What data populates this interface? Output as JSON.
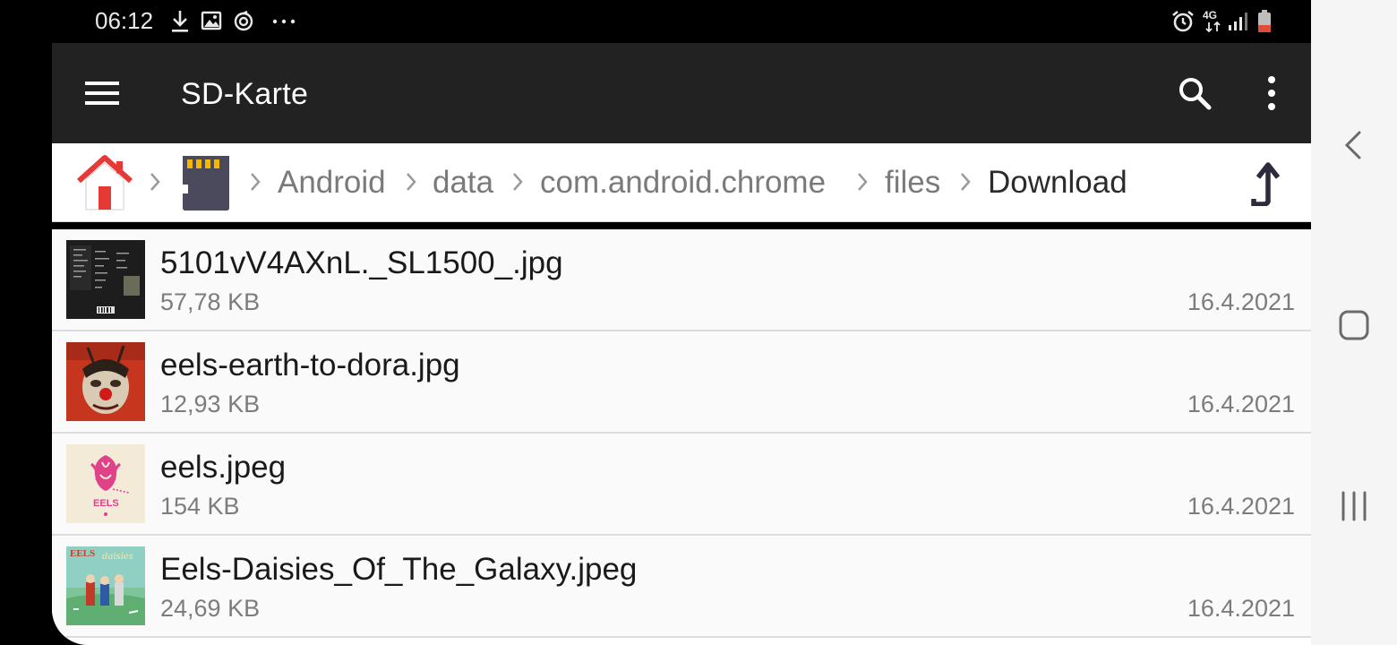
{
  "status_bar": {
    "time": "06:12",
    "left_icons": [
      "download-icon",
      "image-icon",
      "sync-icon",
      "more-dots-icon"
    ],
    "network": "4G",
    "right_icons": [
      "alarm-icon",
      "network-4g-icon",
      "signal-icon",
      "battery-icon"
    ]
  },
  "toolbar": {
    "title": "SD-Karte",
    "menu_icon": "hamburger-menu-icon",
    "search_icon": "search-icon",
    "overflow_icon": "overflow-menu-icon",
    "background": "#222222"
  },
  "breadcrumb": {
    "home_icon": "home-icon",
    "sd_icon": "sd-card-icon",
    "items": [
      "Android",
      "data",
      "com.android.chrome",
      "files",
      "Download"
    ],
    "up_icon": "up-arrow-icon"
  },
  "files": [
    {
      "name": "5101vV4AXnL._SL1500_.jpg",
      "size": "57,78 KB",
      "date": "16.4.2021",
      "thumb": "dark-album-back-thumbnail"
    },
    {
      "name": "eels-earth-to-dora.jpg",
      "size": "12,93 KB",
      "date": "16.4.2021",
      "thumb": "clown-painting-thumbnail"
    },
    {
      "name": "eels.jpeg",
      "size": "154 KB",
      "date": "16.4.2021",
      "thumb": "pink-eels-logo-thumbnail",
      "thumb_text": "EELS"
    },
    {
      "name": "Eels-Daisies_Of_The_Galaxy.jpeg",
      "size": "24,69 KB",
      "date": "16.4.2021",
      "thumb": "daisies-album-thumbnail",
      "thumb_text": "EELS"
    }
  ],
  "navigation_bar": {
    "buttons": [
      "back-icon",
      "home-nav-icon",
      "recents-icon"
    ]
  }
}
